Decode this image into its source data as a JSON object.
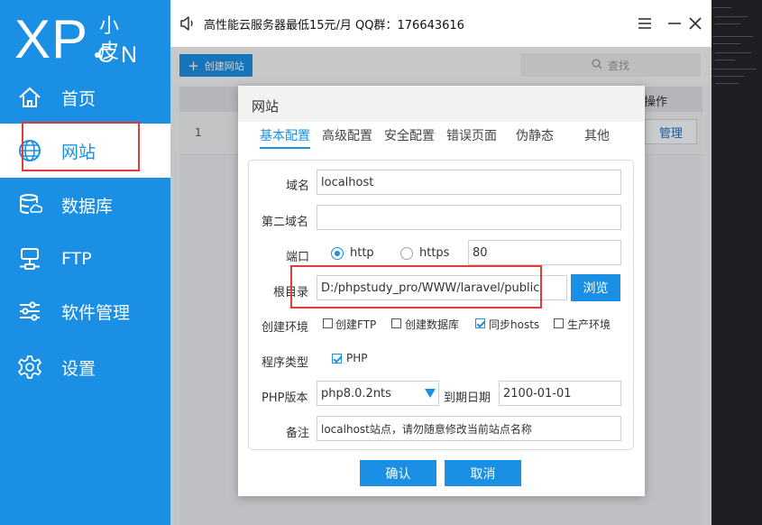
{
  "app": {
    "logo_main": "XP",
    "logo_top": "小皮",
    "logo_bottom": "CN"
  },
  "sidebar": {
    "items": [
      {
        "label": "首页",
        "icon": "home-icon"
      },
      {
        "label": "网站",
        "icon": "globe-icon",
        "active": true
      },
      {
        "label": "数据库",
        "icon": "database-icon"
      },
      {
        "label": "FTP",
        "icon": "ftp-server-icon"
      },
      {
        "label": "软件管理",
        "icon": "sliders-icon"
      },
      {
        "label": "设置",
        "icon": "gear-icon"
      }
    ]
  },
  "titlebar": {
    "text": "高性能云服务器最低15元/月  QQ群：176643616"
  },
  "toolbar": {
    "create_label": "创建网站",
    "search_label": "查找"
  },
  "table": {
    "op_header": "操作",
    "rows": [
      {
        "num": "1",
        "manage_label": "管理"
      }
    ]
  },
  "dialog": {
    "title": "网站",
    "tabs": [
      "基本配置",
      "高级配置",
      "安全配置",
      "错误页面",
      "伪静态",
      "其他"
    ],
    "active_tab": "基本配置",
    "fields": {
      "domain_label": "域名",
      "domain_value": "localhost",
      "second_domain_label": "第二域名",
      "second_domain_value": "",
      "port_label": "端口",
      "http_label": "http",
      "https_label": "https",
      "port_value": "80",
      "root_label": "根目录",
      "root_value": "D:/phpstudy_pro/WWW/laravel/public",
      "browse_label": "浏览",
      "env_label": "创建环境",
      "env_options": [
        {
          "label": "创建FTP",
          "checked": false
        },
        {
          "label": "创建数据库",
          "checked": false
        },
        {
          "label": "同步hosts",
          "checked": true
        },
        {
          "label": "生产环境",
          "checked": false
        }
      ],
      "program_label": "程序类型",
      "program_option": "PHP",
      "php_version_label": "PHP版本",
      "php_version_value": "php8.0.2nts",
      "expire_label": "到期日期",
      "expire_value": "2100-01-01",
      "note_label": "备注",
      "note_value": "localhost站点，请勿随意修改当前站点名称"
    },
    "ok_label": "确认",
    "cancel_label": "取消"
  },
  "colors": {
    "brand_blue": "#1b8fe3",
    "highlight_red": "#e23b3b"
  }
}
